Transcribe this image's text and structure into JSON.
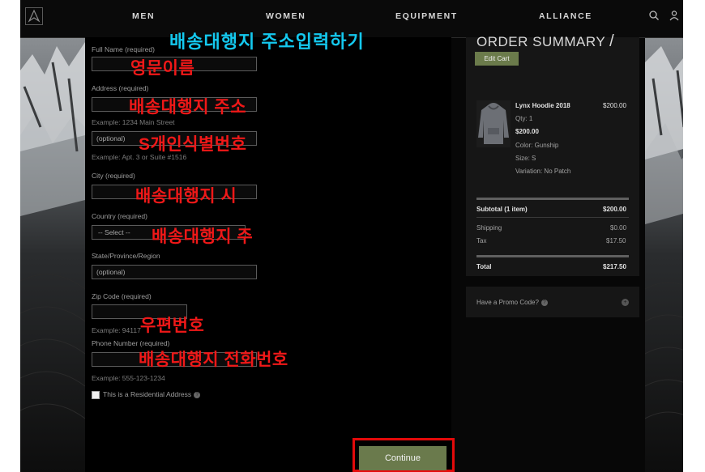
{
  "nav": {
    "links": [
      "MEN",
      "WOMEN",
      "EQUIPMENT",
      "ALLIANCE"
    ],
    "search_icon": "search-icon",
    "account_icon": "user-icon"
  },
  "annotation": {
    "title": "배송대행지 주소입력하기",
    "name": "영문이름",
    "address": "배송대행지 주소",
    "personal_id": "S개인식별번호",
    "city": "배송대행지 시",
    "state": "배송대행지 주",
    "zip": "우편번호",
    "phone": "배송대행지 전화번호"
  },
  "form": {
    "full_name_label": "Full Name (required)",
    "address_label": "Address (required)",
    "address_example": "Example: 1234 Main Street",
    "address2_placeholder": "(optional)",
    "address2_example": "Example: Apt. 3 or Suite #1516",
    "city_label": "City (required)",
    "country_label": "Country (required)",
    "country_value": "-- Select --",
    "state_label": "State/Province/Region",
    "state_placeholder": "(optional)",
    "zip_label": "Zip Code (required)",
    "zip_example": "Example: 94117",
    "phone_label": "Phone Number (required)",
    "phone_example": "Example: 555-123-1234",
    "residential_label": "This is a Residential Address",
    "continue_label": "Continue"
  },
  "summary": {
    "title": "ORDER SUMMARY",
    "edit_cart": "Edit Cart",
    "item": {
      "name": "Lynx Hoodie 2018",
      "price": "$200.00",
      "qty": "Qty: 1",
      "unit_price": "$200.00",
      "color": "Color: Gunship",
      "size": "Size: S",
      "variation": "Variation: No Patch"
    },
    "subtotal_label": "Subtotal (1 item)",
    "subtotal_value": "$200.00",
    "shipping_label": "Shipping",
    "shipping_value": "$0.00",
    "tax_label": "Tax",
    "tax_value": "$17.50",
    "total_label": "Total",
    "total_value": "$217.50",
    "promo_label": "Have a Promo Code?"
  },
  "colors": {
    "accent_button": "#6a7a4c",
    "annotation_red": "#f01818",
    "annotation_cyan": "#14c8ee"
  }
}
